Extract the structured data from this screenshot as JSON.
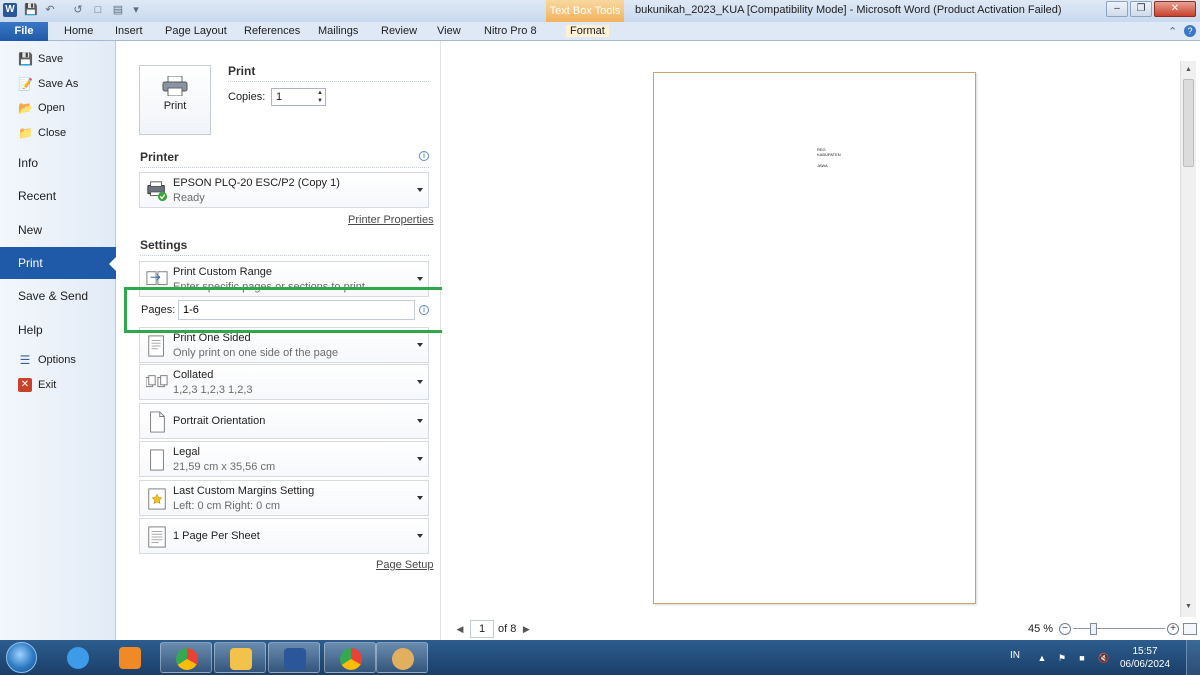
{
  "window": {
    "title": "bukunikah_2023_KUA [Compatibility Mode]  -  Microsoft Word (Product Activation Failed)",
    "contextual_tab": "Text Box Tools",
    "app_logo": "W"
  },
  "ribbon": {
    "file_tab": "File",
    "tabs": [
      "Home",
      "Insert",
      "Page Layout",
      "References",
      "Mailings",
      "Review",
      "View",
      "Nitro Pro 8",
      "Format"
    ]
  },
  "backstage_nav": {
    "commands": [
      {
        "label": "Save",
        "icon": "save-icon"
      },
      {
        "label": "Save As",
        "icon": "save-as-icon"
      },
      {
        "label": "Open",
        "icon": "open-folder-icon"
      },
      {
        "label": "Close",
        "icon": "close-document-icon"
      }
    ],
    "items": [
      "Info",
      "Recent",
      "New",
      "Print",
      "Save & Send",
      "Help"
    ],
    "bottom_commands": [
      {
        "label": "Options",
        "icon": "options-icon"
      },
      {
        "label": "Exit",
        "icon": "exit-icon"
      }
    ],
    "selected": "Print"
  },
  "print": {
    "section_title": "Print",
    "button_label": "Print",
    "copies_label": "Copies:",
    "copies_value": "1"
  },
  "printer": {
    "section_title": "Printer",
    "name": "EPSON PLQ-20 ESC/P2 (Copy 1)",
    "status": "Ready",
    "properties_link": "Printer Properties"
  },
  "settings": {
    "section_title": "Settings",
    "range": {
      "main": "Print Custom Range",
      "sub": "Enter specific pages or sections to print"
    },
    "pages_label": "Pages:",
    "pages_value": "1-6",
    "sided": {
      "main": "Print One Sided",
      "sub": "Only print on one side of the page"
    },
    "collated": {
      "main": "Collated",
      "sub": "1,2,3    1,2,3    1,2,3"
    },
    "orientation": {
      "main": "Portrait Orientation"
    },
    "paper": {
      "main": "Legal",
      "sub": "21,59 cm x 35,56 cm"
    },
    "margins": {
      "main": "Last Custom Margins Setting",
      "sub": "Left:  0 cm    Right:  0 cm"
    },
    "per_sheet": {
      "main": "1 Page Per Sheet"
    },
    "page_setup_link": "Page Setup"
  },
  "preview": {
    "page_lines": [
      "REG",
      "KABUPATEN",
      "JAWA"
    ],
    "current_page": "1",
    "of_pages": "of 8",
    "zoom": "45 %",
    "zoom_level_percent": 45
  },
  "taskbar": {
    "apps": [
      {
        "icon": "internet-explorer-icon",
        "state": "pinned",
        "color": "#3d9be9"
      },
      {
        "icon": "media-player-icon",
        "state": "pinned",
        "color": "#f08a24"
      },
      {
        "icon": "chrome-icon",
        "state": "running",
        "color": "#e94235"
      },
      {
        "icon": "file-explorer-icon",
        "state": "running",
        "color": "#f2c24b"
      },
      {
        "icon": "word-icon",
        "state": "running",
        "color": "#2b579a"
      },
      {
        "icon": "chrome-icon",
        "state": "running",
        "color": "#34a853"
      },
      {
        "icon": "paint-icon",
        "state": "running",
        "color": "#e0b060"
      }
    ],
    "language": "IN",
    "time": "15:57",
    "date": "06/06/2024"
  }
}
